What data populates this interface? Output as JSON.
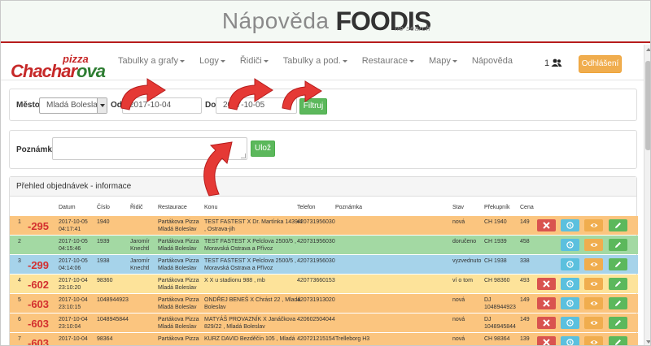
{
  "banner": {
    "title": "Nápověda",
    "brand": "FOODIS",
    "brand_sub": "no search"
  },
  "logo": {
    "top": "pizza",
    "name_a": "Chachar",
    "name_b": "ova"
  },
  "nav": {
    "items": [
      "Tabulky a grafy",
      "Logy",
      "Řidiči",
      "Tabulky a pod.",
      "Restaurace",
      "Mapy",
      "Nápověda"
    ],
    "user_count": "1",
    "logout": "Odhlášení"
  },
  "filter": {
    "city_label": "Město",
    "city_value": "Mladá Boleslav",
    "from_label": "Od",
    "from_value": "2017-10-04",
    "to_label": "Do",
    "to_value": "2017-10-05",
    "filter_button": "Filtruj"
  },
  "note": {
    "label": "Poznámka",
    "save_button": "Ulož"
  },
  "orders": {
    "title": "Přehled objednávek - informace",
    "columns": [
      "Datum",
      "Číslo",
      "Řidič",
      "Restaurace",
      "Konu",
      "Telefon",
      "Poznámka",
      "Stav",
      "Překupník",
      "Cena"
    ],
    "rows": [
      {
        "idx": "1",
        "num": "-295",
        "date": "2017-10-05",
        "time": "04:17:41",
        "cislo": "1940",
        "ridic1": "",
        "ridic2": "",
        "rest1": "Partákova Pizza",
        "rest2": "Mladá Boleslav",
        "konu1": "TEST FASTEST X Dr. Martínka 1439/4",
        "konu2": ", Ostrava-jih",
        "tel": "420731956030",
        "pozn": "",
        "stav": "nová",
        "prek1": "CH 1940",
        "prek2": "",
        "cena": "149",
        "color": "#fbc57f"
      },
      {
        "idx": "2",
        "num": "",
        "date": "2017-10-05",
        "time": "04:15:46",
        "cislo": "1939",
        "ridic1": "Jaromír",
        "ridic2": "Knechtl",
        "rest1": "Partákova Pizza",
        "rest2": "Mladá Boleslav",
        "konu1": "TEST FASTEST X Pelclova 2500/5 ,",
        "konu2": "Moravská Ostrava a Přívoz",
        "tel": "420731956030",
        "pozn": "",
        "stav": "doručeno",
        "prek1": "CH 1939",
        "prek2": "",
        "cena": "458",
        "color": "#a3d9a3"
      },
      {
        "idx": "3",
        "num": "-299",
        "date": "2017-10-05",
        "time": "04:14:06",
        "cislo": "1938",
        "ridic1": "Jaromír",
        "ridic2": "Knechtl",
        "rest1": "Partákova Pizza",
        "rest2": "Mladá Boleslav",
        "konu1": "TEST FASTEST X Pelclova 2500/5 ,",
        "konu2": "Moravská Ostrava a Přívoz",
        "tel": "420731956030",
        "pozn": "",
        "stav": "vyzvednuto",
        "prek1": "CH 1938",
        "prek2": "",
        "cena": "338",
        "color": "#a6d3ea"
      },
      {
        "idx": "4",
        "num": "-602",
        "date": "2017-10-04",
        "time": "23:10:20",
        "cislo": "98360",
        "ridic1": "",
        "ridic2": "",
        "rest1": "Partákova Pizza",
        "rest2": "Mladá Boleslav",
        "konu1": "X X u stadionu 988 , mb",
        "konu2": "",
        "tel": "420773660153",
        "pozn": "",
        "stav": "ví o tom",
        "prek1": "CH 98360",
        "prek2": "",
        "cena": "493",
        "color": "#fde39a"
      },
      {
        "idx": "5",
        "num": "-603",
        "date": "2017-10-04",
        "time": "23:10:15",
        "cislo": "1048944923",
        "ridic1": "",
        "ridic2": "",
        "rest1": "Partákova Pizza",
        "rest2": "Mladá Boleslav",
        "konu1": "ONDŘEJ BENEŠ X Chrást 22 , Mladá",
        "konu2": "Boleslav",
        "tel": "420731913020",
        "pozn": "",
        "stav": "nová",
        "prek1": "DJ",
        "prek2": "1048944923",
        "cena": "149",
        "color": "#fbc57f"
      },
      {
        "idx": "6",
        "num": "-603",
        "date": "2017-10-04",
        "time": "23:10:04",
        "cislo": "1048945844",
        "ridic1": "",
        "ridic2": "",
        "rest1": "Partákova Pizza",
        "rest2": "Mladá Boleslav",
        "konu1": "MATYÁŠ PROVAZNÍK X Janáčkova",
        "konu2": "829/22 , Mladá Boleslav",
        "tel": "420602504044",
        "pozn": "",
        "stav": "nová",
        "prek1": "DJ",
        "prek2": "1048945844",
        "cena": "149",
        "color": "#fbc57f"
      },
      {
        "idx": "7",
        "num": "-603",
        "date": "2017-10-04",
        "time": "",
        "cislo": "98364",
        "ridic1": "",
        "ridic2": "",
        "rest1": "Partákova Pizza",
        "rest2": "",
        "konu1": "KURZ DAVID Bezděčín 105 , Mladá",
        "konu2": "",
        "tel": "420721215154",
        "pozn": "Trelleborg H3",
        "stav": "nová",
        "prek1": "CH 98364",
        "prek2": "",
        "cena": "139",
        "color": "#fbc57f"
      }
    ]
  },
  "icons": {
    "remove": "remove-icon",
    "clock": "clock-icon",
    "eye": "eye-icon",
    "edit": "pencil-icon",
    "users": "users-icon"
  }
}
